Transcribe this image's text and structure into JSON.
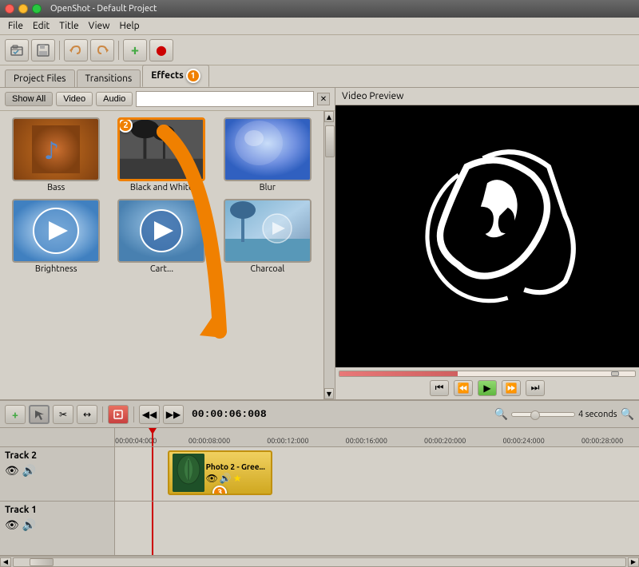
{
  "app": {
    "title": "OpenShot - Default Project"
  },
  "titlebar": {
    "close_label": "",
    "min_label": "",
    "max_label": ""
  },
  "menubar": {
    "items": [
      "File",
      "Edit",
      "Title",
      "View",
      "Help"
    ]
  },
  "toolbar": {
    "buttons": [
      "open-icon",
      "save-icon",
      "undo-icon",
      "redo-icon",
      "add-icon",
      "record-icon"
    ]
  },
  "tabs": {
    "items": [
      {
        "label": "Project Files",
        "active": false
      },
      {
        "label": "Transitions",
        "active": false
      },
      {
        "label": "Effects",
        "active": true,
        "badge": "1"
      }
    ]
  },
  "filter": {
    "buttons": [
      "Show All",
      "Video",
      "Audio"
    ],
    "active": "Show All",
    "search_placeholder": ""
  },
  "effects": {
    "items": [
      {
        "id": "bass",
        "label": "Bass",
        "selected": false
      },
      {
        "id": "black_and_white",
        "label": "Black and White",
        "selected": true,
        "badge": "2"
      },
      {
        "id": "blur",
        "label": "Blur",
        "selected": false
      },
      {
        "id": "brightness",
        "label": "Brightness",
        "selected": false
      },
      {
        "id": "cartoon",
        "label": "Cart...",
        "selected": false
      },
      {
        "id": "charcoal",
        "label": "Charcoal",
        "selected": false
      }
    ]
  },
  "preview": {
    "label": "Video Preview"
  },
  "timeline_toolbar": {
    "time_code": "00:00:06:008",
    "zoom_label": "4 seconds"
  },
  "ruler": {
    "marks": [
      {
        "pos_pct": 0,
        "label": "00:00:04:000"
      },
      {
        "pos_pct": 15,
        "label": "00:00:08:000"
      },
      {
        "pos_pct": 30,
        "label": "00:00:12:000"
      },
      {
        "pos_pct": 45,
        "label": "00:00:16:000"
      },
      {
        "pos_pct": 60,
        "label": "00:00:20:000"
      },
      {
        "pos_pct": 75,
        "label": "00:00:24:000"
      },
      {
        "pos_pct": 90,
        "label": "00:00:28:000"
      }
    ]
  },
  "tracks": [
    {
      "name": "Track 2",
      "clip": {
        "title": "Photo 2 - Gree...",
        "left_pct": 10,
        "width_pct": 20,
        "badge": "3"
      }
    },
    {
      "name": "Track 1",
      "clip": null
    }
  ]
}
